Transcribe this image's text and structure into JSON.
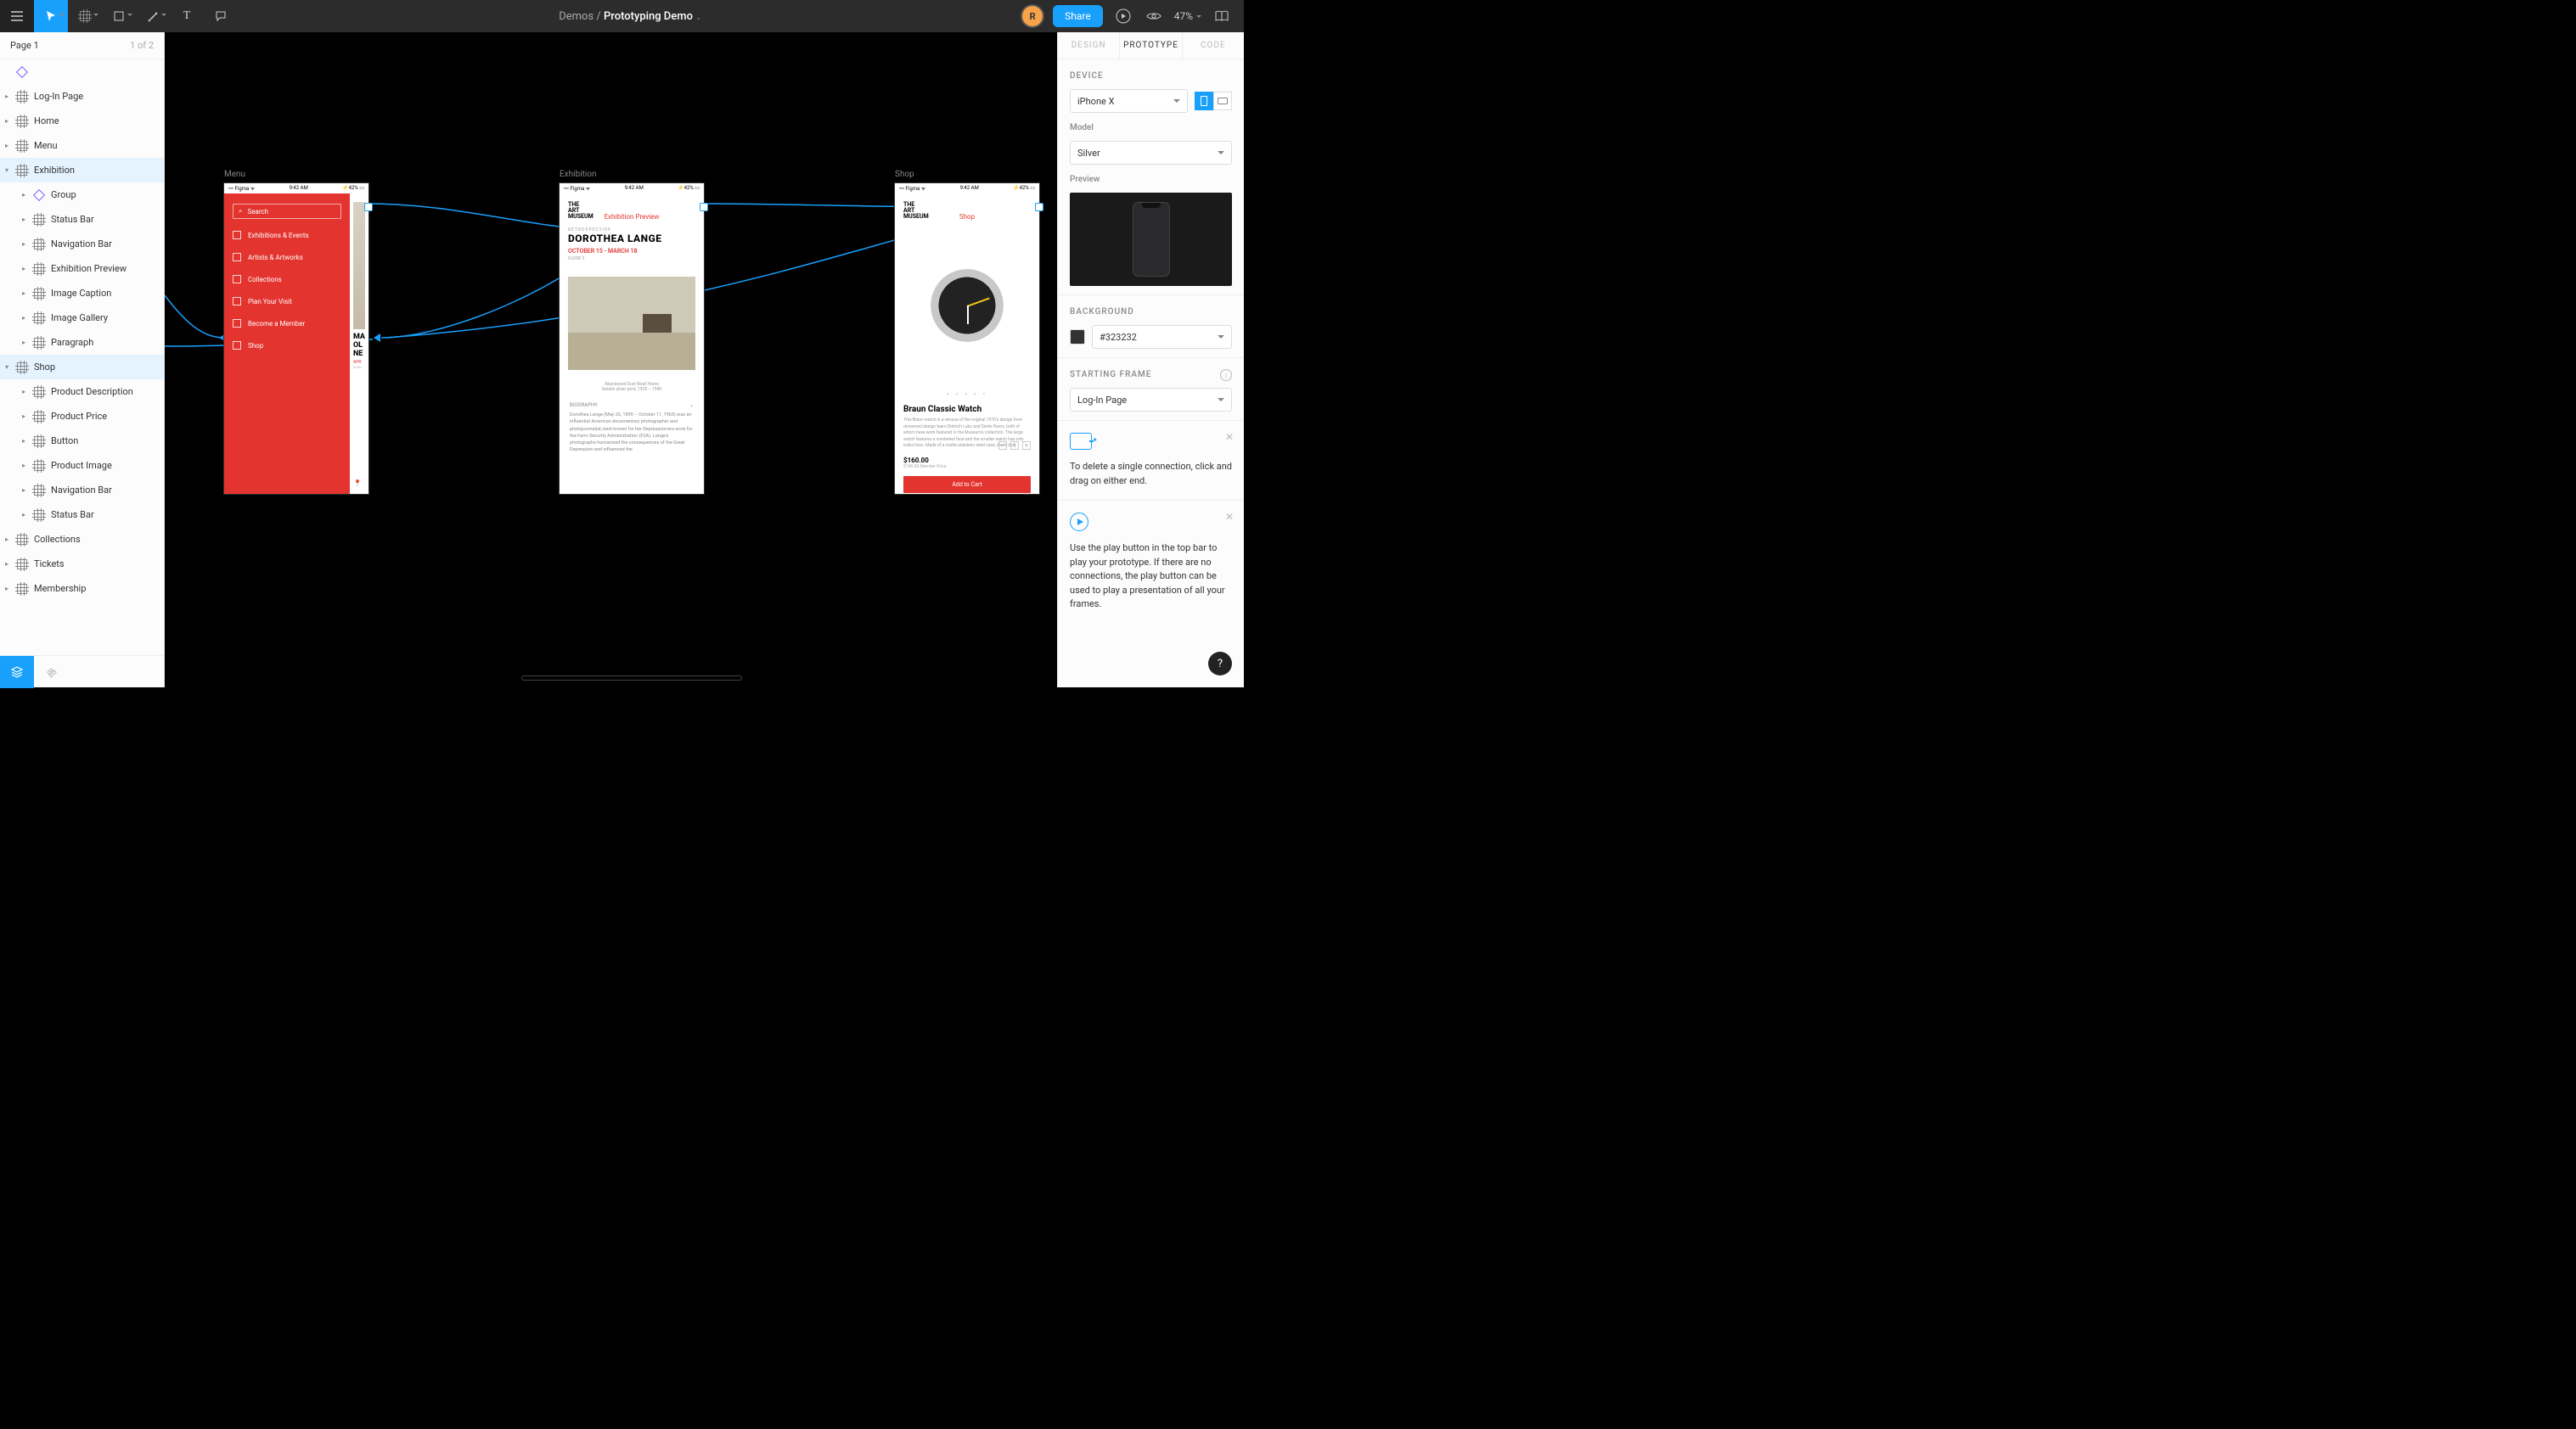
{
  "topbar": {
    "breadcrumb_parent": "Demos",
    "breadcrumb_current": "Prototyping Demo",
    "avatar_initial": "R",
    "share": "Share",
    "zoom": "47%"
  },
  "left": {
    "page_name": "Page 1",
    "page_count": "1 of 2",
    "layers": [
      {
        "label": "",
        "depth": 1,
        "icon": "diamond",
        "expandable": false
      },
      {
        "label": "Log-In Page",
        "depth": 1,
        "icon": "frame",
        "expandable": true
      },
      {
        "label": "Home",
        "depth": 1,
        "icon": "frame",
        "expandable": true
      },
      {
        "label": "Menu",
        "depth": 1,
        "icon": "frame",
        "expandable": true
      },
      {
        "label": "Exhibition",
        "depth": 1,
        "icon": "frame",
        "expandable": true,
        "expanded": true,
        "selected": true
      },
      {
        "label": "Group",
        "depth": 3,
        "icon": "diamond",
        "expandable": true
      },
      {
        "label": "Status Bar",
        "depth": 3,
        "icon": "frame",
        "expandable": true
      },
      {
        "label": "Navigation Bar",
        "depth": 3,
        "icon": "frame",
        "expandable": true
      },
      {
        "label": "Exhibition Preview",
        "depth": 3,
        "icon": "frame",
        "expandable": true
      },
      {
        "label": "Image Caption",
        "depth": 3,
        "icon": "frame",
        "expandable": true
      },
      {
        "label": "Image Gallery",
        "depth": 3,
        "icon": "frame",
        "expandable": true
      },
      {
        "label": "Paragraph",
        "depth": 3,
        "icon": "frame",
        "expandable": true
      },
      {
        "label": "Shop",
        "depth": 1,
        "icon": "frame",
        "expandable": true,
        "expanded": true,
        "selected": true
      },
      {
        "label": "Product Description",
        "depth": 3,
        "icon": "frame",
        "expandable": true
      },
      {
        "label": "Product Price",
        "depth": 3,
        "icon": "frame",
        "expandable": true
      },
      {
        "label": "Button",
        "depth": 3,
        "icon": "frame",
        "expandable": true
      },
      {
        "label": "Product Image",
        "depth": 3,
        "icon": "frame",
        "expandable": true
      },
      {
        "label": "Navigation Bar",
        "depth": 3,
        "icon": "frame",
        "expandable": true
      },
      {
        "label": "Status Bar",
        "depth": 3,
        "icon": "frame",
        "expandable": true
      },
      {
        "label": "Collections",
        "depth": 1,
        "icon": "frame",
        "expandable": true
      },
      {
        "label": "Tickets",
        "depth": 1,
        "icon": "frame",
        "expandable": true
      },
      {
        "label": "Membership",
        "depth": 1,
        "icon": "frame",
        "expandable": true
      }
    ]
  },
  "canvas": {
    "frames": {
      "menu": {
        "label": "Menu",
        "status_left": "••• Figma ᯤ",
        "status_time": "9:42 AM",
        "status_right": "⚡42% ▭",
        "search": "Search",
        "items": [
          "Exhibitions & Events",
          "Artists & Artworks",
          "Collections",
          "Plan Your Visit",
          "Become a Member",
          "Shop"
        ],
        "peek_h1": "MA",
        "peek_h2": "OL",
        "peek_h3": "NE",
        "peek_sub": "APR",
        "peek_floor": "FLOO",
        "peek_pin": "📍"
      },
      "exhibition": {
        "label": "Exhibition",
        "status_left": "••• Figma ᯤ",
        "status_time": "9:42 AM",
        "status_right": "⚡42% ▭",
        "brand": "THE\nART\nMUSEUM",
        "preview": "Exhibition Preview",
        "retro": "RETROSPECTIVE",
        "title": "DOROTHEA LANGE",
        "dates": "OCTOBER 15 - MARCH 18",
        "floor": "FLOOR 3",
        "caption": "Abandoned Dust Bowl Home\nGelatin silver print, 1935 – 1940",
        "bio_head": "BIOGRAPHY",
        "bio": "Dorothea Lange (May 26, 1895 – October 11, 1965) was an influential American documentary photographer and photojournalist, best known for her Depression-era work for the Farm Security Administration (FSA). Lange's photographs humanized the consequences of the Great Depression and influenced the"
      },
      "shop": {
        "label": "Shop",
        "status_left": "••• Figma ᯤ",
        "status_time": "9:42 AM",
        "status_right": "⚡42% ▭",
        "brand": "THE\nART\nMUSEUM",
        "shop_t": "Shop",
        "dots": "• • • • •",
        "title": "Braun Classic Watch",
        "desc": "This Braun watch is a reissue of the original 1970's design from renowned design team Dietrich Lubs and Dieter Rams, both of whom have work featured in the Museum's collection. The large watch features a numbered face and the smaller watch has only index lines. Made of a matte stainless steel case, black dial.",
        "price": "$160.00",
        "member": "$140.00 Member Price",
        "qty": "1",
        "cart": "Add to Cart"
      }
    }
  },
  "right": {
    "tabs": [
      "DESIGN",
      "PROTOTYPE",
      "CODE"
    ],
    "device_h": "DEVICE",
    "device": "iPhone X",
    "model_h": "Model",
    "model": "Silver",
    "preview_h": "Preview",
    "bg_h": "BACKGROUND",
    "bg_hex": "#323232",
    "start_h": "STARTING FRAME",
    "start": "Log-In Page",
    "hint1": "To delete a single connection, click and drag on either end.",
    "hint2": "Use the play button in the top bar to play your prototype. If there are no connections, the play button can be used to play a presentation of all your frames."
  },
  "help": "?"
}
